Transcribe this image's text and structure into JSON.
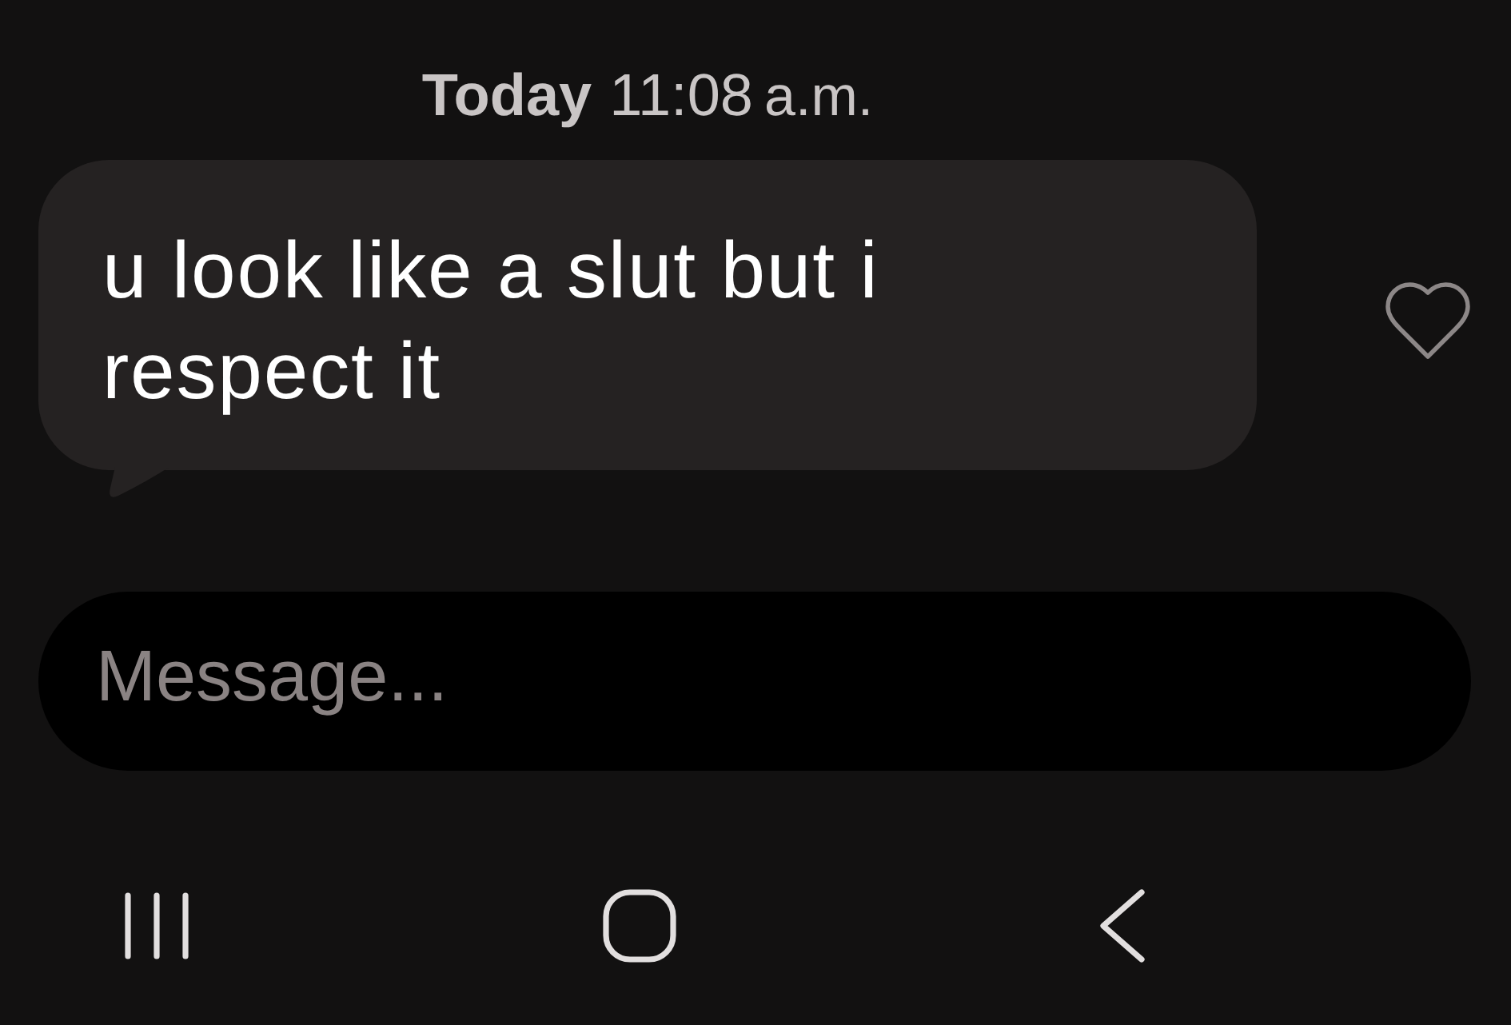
{
  "timestamp": {
    "day": "Today",
    "time": "11:08",
    "period": "a.m."
  },
  "messages": [
    {
      "text": "u look like a slut but i respect it",
      "liked": false
    }
  ],
  "composer": {
    "placeholder": "Message..."
  },
  "nav_bar": [
    {
      "kind": "recents"
    },
    {
      "kind": "home"
    },
    {
      "kind": "back"
    }
  ]
}
